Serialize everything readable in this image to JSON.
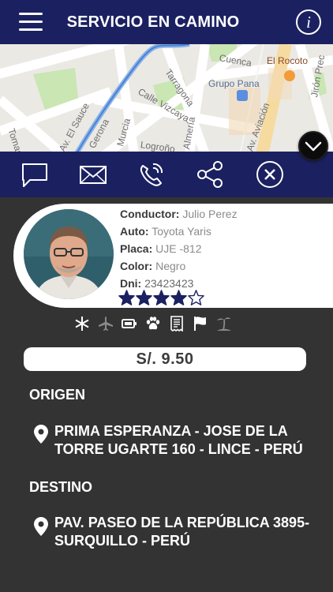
{
  "header": {
    "title": "SERVICIO EN CAMINO",
    "menu_icon": "hamburger-menu-icon",
    "info_icon": "info-icon",
    "info_glyph": "i",
    "background": "#1b2160"
  },
  "map": {
    "labels": [
      "Tomas",
      "Av. El Sauce",
      "Gerona",
      "Calle Vizcaya",
      "Murcia",
      "Tarragona",
      "Almería",
      "Logroño",
      "Cuenca",
      "Av. Aviación",
      "Jirón Prec"
    ],
    "pois": [
      "El Rocoto",
      "Grupo Pana"
    ]
  },
  "actions": [
    {
      "name": "chat",
      "icon": "chat-bubble-icon"
    },
    {
      "name": "message",
      "icon": "envelope-icon"
    },
    {
      "name": "call",
      "icon": "phone-icon"
    },
    {
      "name": "share",
      "icon": "share-icon"
    },
    {
      "name": "cancel",
      "icon": "close-circle-icon"
    },
    {
      "name": "collapse",
      "icon": "chevron-down-icon"
    }
  ],
  "driver": {
    "conductor_label": "Conductor:",
    "conductor": "Julio Perez",
    "auto_label": "Auto:",
    "auto": "Toyota Yaris",
    "placa_label": "Placa:",
    "placa": "UJE -812",
    "color_label": "Color:",
    "color": "Negro",
    "dni_label": "Dni:",
    "dni": "23423423",
    "rating": 4,
    "rating_max": 5
  },
  "amenities": [
    "snowflake-icon",
    "airplane-icon",
    "battery-icon",
    "paw-icon",
    "receipt-icon",
    "flag-icon",
    "beach-icon"
  ],
  "price": "S/. 9.50",
  "trip": {
    "origin_label": "ORIGEN",
    "origin_line1": "PRIMA ESPERANZA - JOSE DE LA",
    "origin_line2": "TORRE UGARTE 160 - LINCE - PERÚ",
    "destination_label": "DESTINO",
    "destination_line1": "PAV. PASEO DE LA REPÚBLICA 3895-",
    "destination_line2": "SURQUILLO - PERÚ"
  },
  "colors": {
    "brand_navy": "#1b2160",
    "panel_dark": "#333333",
    "star": "#1b2160",
    "white": "#ffffff"
  }
}
